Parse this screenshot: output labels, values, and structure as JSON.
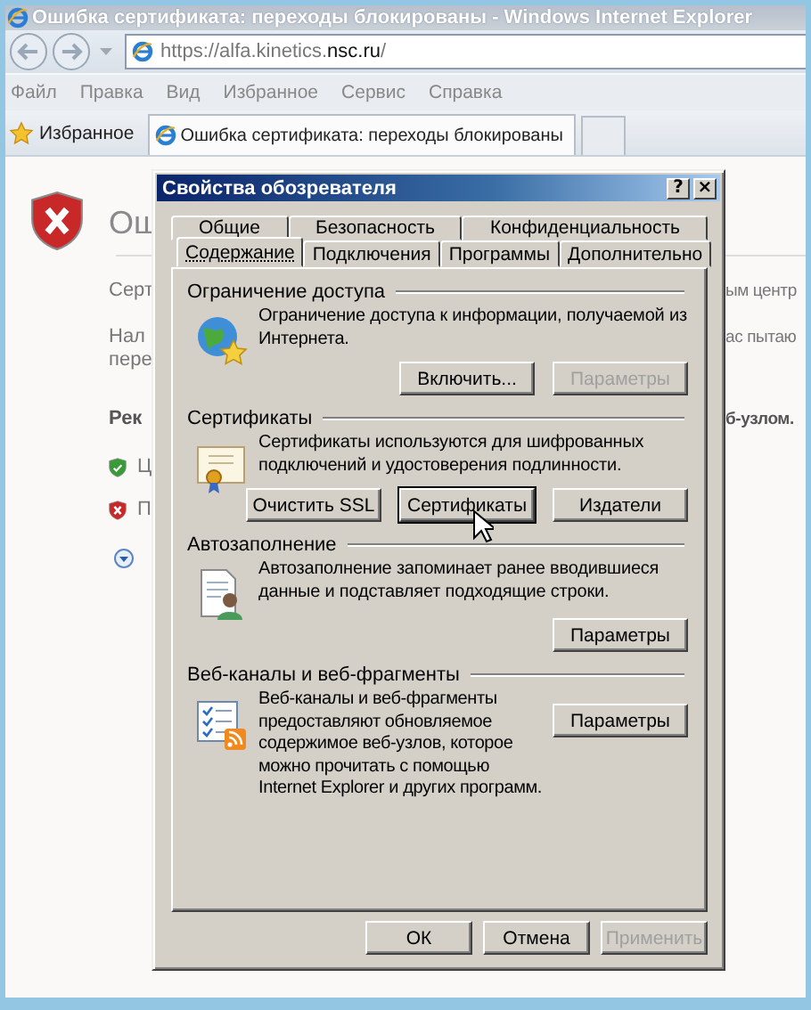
{
  "browser": {
    "title": "Ошибка сертификата: переходы блокированы - Windows Internet Explorer",
    "address": "https://alfa.kinetics.**nsc.ru**/",
    "menu": [
      "Файл",
      "Правка",
      "Вид",
      "Избранное",
      "Сервис",
      "Справка"
    ],
    "favorites": "Избранное",
    "tabs": [
      {
        "label": "Ошибка сертификата: переходы блокированы",
        "selected": true
      }
    ]
  },
  "page": {
    "blocks": [
      {
        "kind": "heading",
        "left": "Ош"
      },
      {
        "kind": "rule"
      },
      {
        "kind": "text",
        "lines": [
          {
            "left": "Серт",
            "right": "ым центр"
          }
        ]
      },
      {
        "kind": "text",
        "lines": [
          {
            "left": "Нал",
            "right": "ас пытаю"
          },
          {
            "left": "пере"
          }
        ]
      },
      {
        "kind": "bold",
        "lines": [
          {
            "left": "Рек",
            "right": "б-узлом."
          }
        ]
      },
      {
        "kind": "ok",
        "left": "Ц"
      },
      {
        "kind": "error",
        "left": "П"
      },
      {
        "kind": "more"
      }
    ]
  },
  "dialog": {
    "title": "Свойства обозревателя",
    "help_button": "?",
    "close_button": "×",
    "tab_rows": [
      [
        {
          "label": "Общие",
          "selected": false
        },
        {
          "label": "Безопасность",
          "selected": false
        },
        {
          "label": "Конфиденциальность",
          "selected": false
        }
      ],
      [
        {
          "label": "Содержание",
          "selected": true
        },
        {
          "label": "Подключения",
          "selected": false
        },
        {
          "label": "Программы",
          "selected": false
        },
        {
          "label": "Дополнительно",
          "selected": false
        }
      ]
    ],
    "groups": [
      {
        "kind": "ratings",
        "title": "Ограничение доступа",
        "text": "Ограничение доступа к информации, получаемой из\nИнтернета.",
        "buttons": [
          {
            "label": "Включить...",
            "disabled": false,
            "focused": false
          },
          {
            "label": "Параметры",
            "disabled": true,
            "focused": false
          }
        ]
      },
      {
        "kind": "certificates",
        "title": "Сертификаты",
        "text": "Сертификаты используются для шифрованных\nподключений и удостоверения подлинности.",
        "buttons": [
          {
            "label": "Очистить SSL",
            "disabled": false,
            "focused": false
          },
          {
            "label": "Сертификаты",
            "disabled": false,
            "focused": true
          },
          {
            "label": "Издатели",
            "disabled": false,
            "focused": false
          }
        ]
      },
      {
        "kind": "autocomplete",
        "title": "Автозаполнение",
        "text": "Автозаполнение запоминает ранее вводившиеся\nданные и подставляет подходящие строки.",
        "buttons": [
          {
            "label": "Параметры",
            "disabled": false,
            "focused": false
          }
        ]
      },
      {
        "kind": "feeds",
        "title": "Веб-каналы и веб-фрагменты",
        "text": "Веб-каналы и веб-фрагменты\nпредоставляют обновляемое\nсодержимое веб-узлов, которое\nможно прочитать с помощью\nInternet Explorer и других программ.",
        "buttons": [
          {
            "label": "Параметры",
            "disabled": false,
            "focused": false
          }
        ]
      }
    ],
    "footer": [
      {
        "label": "ОК",
        "disabled": false
      },
      {
        "label": "Отмена",
        "disabled": false
      },
      {
        "label": "Применить",
        "disabled": true
      }
    ]
  }
}
